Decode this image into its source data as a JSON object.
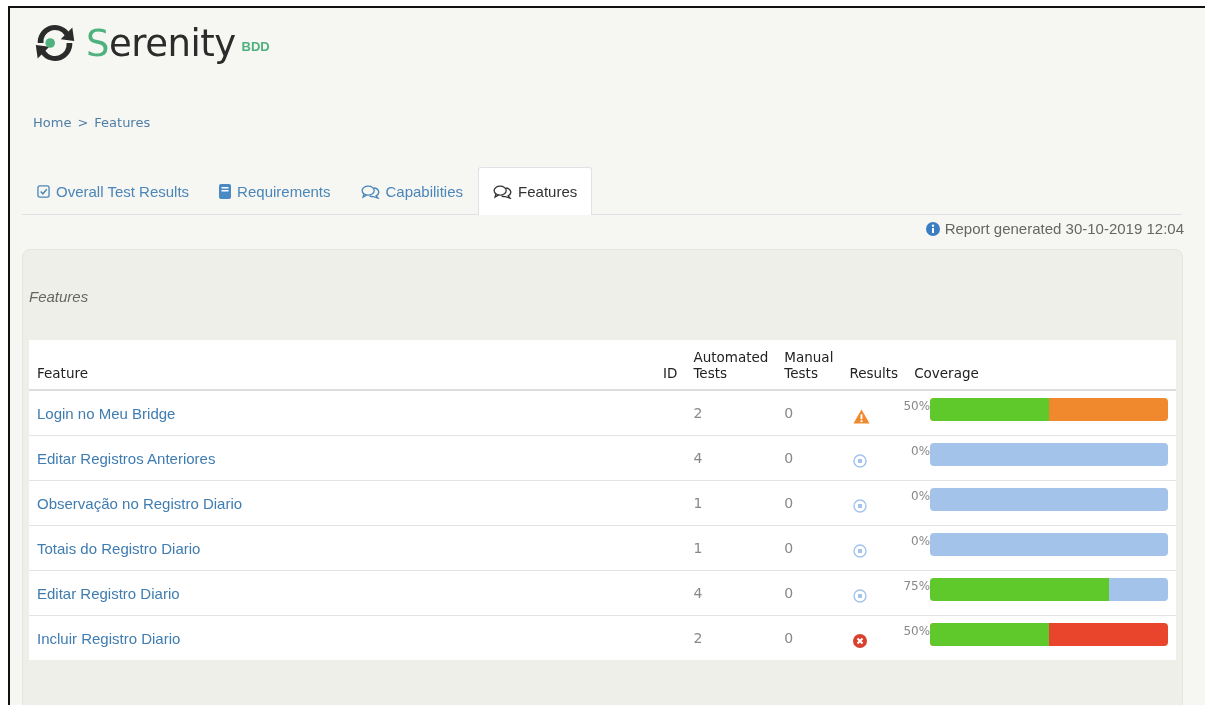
{
  "logo": {
    "name": "Serenity",
    "suffix": "BDD"
  },
  "breadcrumb": [
    {
      "label": "Home"
    },
    {
      "label": ">"
    },
    {
      "label": "Features"
    }
  ],
  "tabs": [
    {
      "label": "Overall Test Results",
      "kind": "check",
      "selected": false
    },
    {
      "label": "Requirements",
      "kind": "book",
      "selected": false
    },
    {
      "label": "Capabilities",
      "kind": "comments",
      "selected": false
    },
    {
      "label": "Features",
      "kind": "comments",
      "selected": true
    }
  ],
  "report_generated": "Report generated 30-10-2019 12:04",
  "panel": {
    "title": "Features",
    "table": {
      "columns": [
        {
          "label": "Feature"
        },
        {
          "label": "ID"
        },
        {
          "label": "Automated Tests"
        },
        {
          "label": "Manual Tests"
        },
        {
          "label": "Results"
        },
        {
          "label": "Coverage"
        }
      ],
      "rows": [
        {
          "feature": "Login no Meu Bridge",
          "automated": "2",
          "manual": "0",
          "kind": "warning",
          "coverage": "50%",
          "level": 0.5
        },
        {
          "feature": "Editar Registros Anteriores",
          "automated": "4",
          "manual": "0",
          "kind": "pending",
          "coverage": "0%"
        },
        {
          "feature": "Observação no Registro Diario",
          "automated": "1",
          "manual": "0",
          "kind": "pending",
          "coverage": "0%"
        },
        {
          "feature": "Totais do Registro Diario",
          "automated": "1",
          "manual": "0",
          "kind": "pending",
          "coverage": "0%"
        },
        {
          "feature": "Editar Registro Diario",
          "automated": "4",
          "manual": "0",
          "kind": "pending",
          "coverage": "75%",
          "level": 0.75
        },
        {
          "feature": "Incluir Registro Diario",
          "automated": "2",
          "manual": "0",
          "kind": "error",
          "coverage": "50%",
          "level": 0.5
        }
      ]
    }
  }
}
